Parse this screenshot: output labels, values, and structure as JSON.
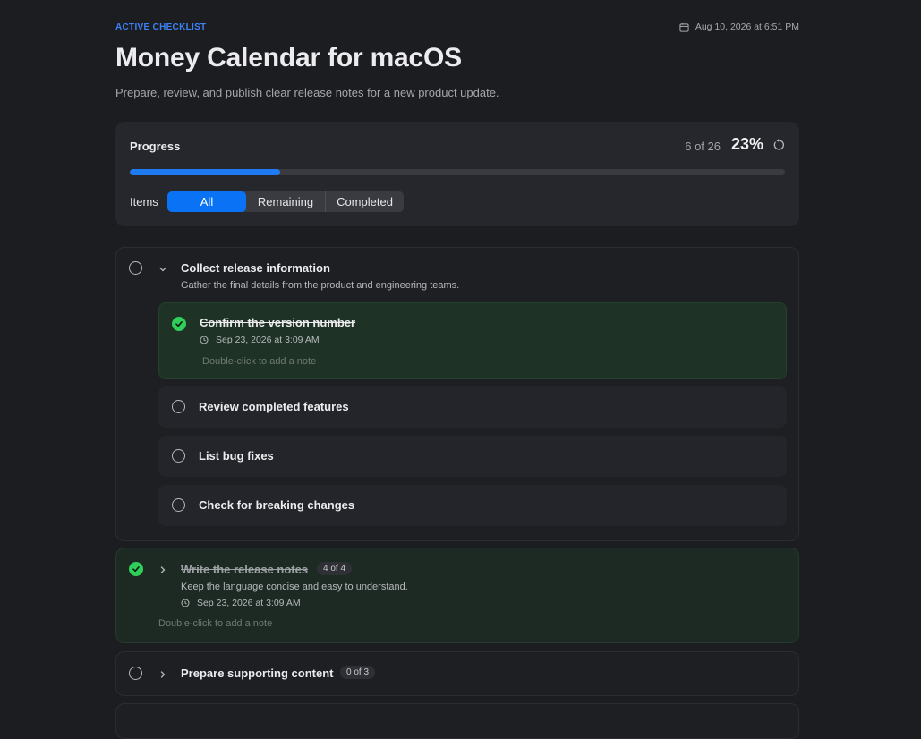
{
  "header": {
    "eyebrow": "ACTIVE CHECKLIST",
    "date": "Aug 10, 2026 at 6:51 PM",
    "title": "Money Calendar for macOS",
    "subtitle": "Prepare, review, and publish clear release notes for a new product update."
  },
  "progress": {
    "title": "Progress",
    "count_text": "6 of 26",
    "percent_text": "23%",
    "fraction": 0.23,
    "items_label": "Items",
    "filters": [
      "All",
      "Remaining",
      "Completed"
    ],
    "selected_filter": "All"
  },
  "groups": [
    {
      "title": "Collect release information",
      "description": "Gather the final details from the product and engineering teams.",
      "completed": false,
      "expanded": true,
      "items": [
        {
          "title": "Confirm the version number",
          "completed": true,
          "date": "Sep 23, 2026 at 3:09 AM",
          "note_hint": "Double-click to add a note"
        },
        {
          "title": "Review completed features",
          "completed": false
        },
        {
          "title": "List bug fixes",
          "completed": false
        },
        {
          "title": "Check for breaking changes",
          "completed": false
        }
      ]
    },
    {
      "title": "Write the release notes",
      "badge": "4 of 4",
      "description": "Keep the language concise and easy to understand.",
      "completed": true,
      "expanded": false,
      "date": "Sep 23, 2026 at 3:09 AM",
      "note_hint": "Double-click to add a note"
    },
    {
      "title": "Prepare supporting content",
      "badge": "0 of 3",
      "completed": false,
      "expanded": false
    }
  ],
  "colors": {
    "accent": "#0a73f5",
    "complete": "#2fcf5a",
    "background": "#1c1d21"
  }
}
